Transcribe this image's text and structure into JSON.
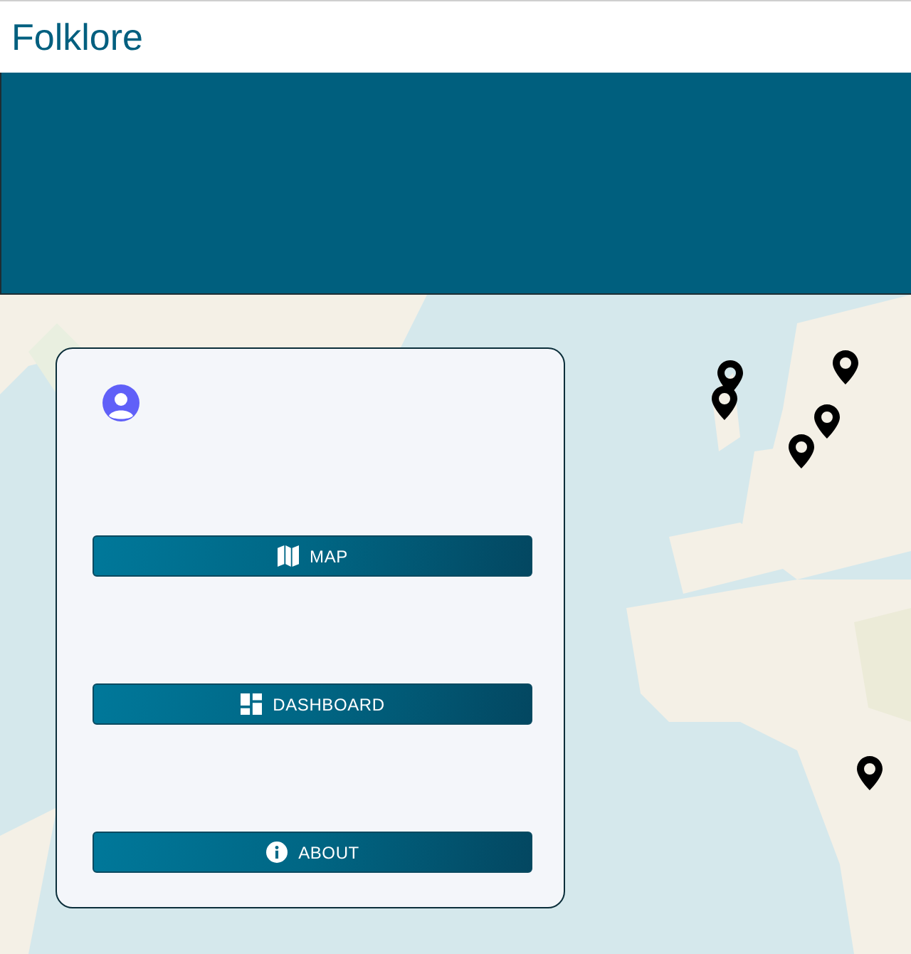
{
  "header": {
    "title": "Folklore"
  },
  "menu": {
    "buttons": [
      {
        "label": "MAP",
        "kind": "map"
      },
      {
        "label": "DASHBOARD",
        "kind": "dashboard"
      },
      {
        "label": "ABOUT",
        "kind": "about"
      }
    ]
  }
}
